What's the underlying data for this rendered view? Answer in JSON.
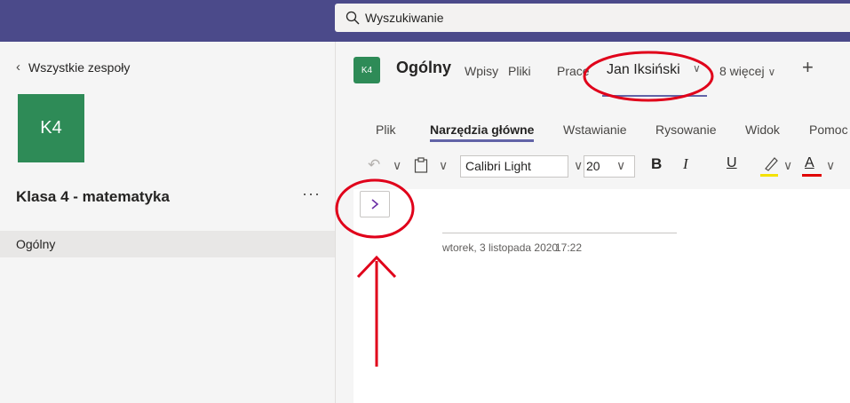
{
  "search": {
    "placeholder": "Wyszukiwanie"
  },
  "sidebar": {
    "back_label": "Wszystkie zespoły",
    "team_initials": "K4",
    "team_name": "Klasa 4 - matematyka",
    "more": "···",
    "channels": [
      {
        "label": "Ogólny"
      }
    ]
  },
  "channel": {
    "initials": "K4",
    "title": "Ogólny",
    "tabs": [
      "Wpisy",
      "Pliki",
      "Prace"
    ],
    "active_tab": "Jan Iksiński",
    "more_tabs": "8 więcej",
    "add": "+"
  },
  "ribbon": {
    "tabs": [
      "Plik",
      "Narzędzia główne",
      "Wstawianie",
      "Rysowanie",
      "Widok",
      "Pomoc"
    ],
    "active_tab": "Narzędzia główne",
    "font": "Calibri Light",
    "font_size": "20",
    "bold": "B",
    "italic": "I",
    "underline": "U",
    "font_color": "A",
    "highlight_color": "#f4e200",
    "font_color_value": "#e00000"
  },
  "page": {
    "date": "wtorek, 3 listopada 2020",
    "time": "17:22"
  },
  "colors": {
    "brand": "#4b4a8a",
    "accent": "#6264a7",
    "team_tile": "#2e8b57",
    "annotation": "#e0001a"
  }
}
